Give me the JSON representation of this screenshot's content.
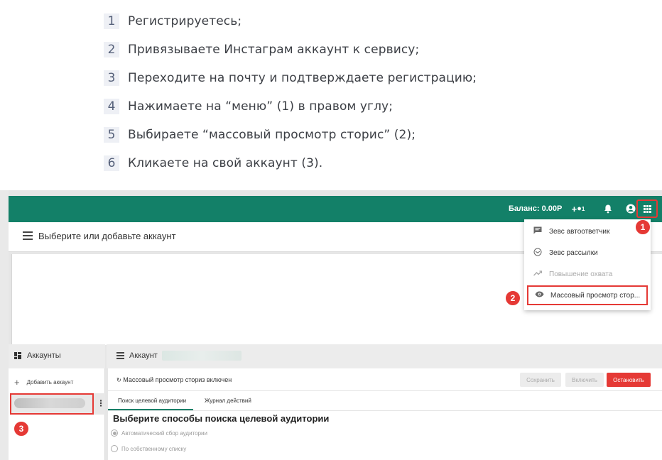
{
  "steps": [
    {
      "num": "1",
      "text": "Регистрируетесь;"
    },
    {
      "num": "2",
      "text": "Привязываете Инстаграм аккаунт к сервису;"
    },
    {
      "num": "3",
      "text": "Переходите на почту и подтверждаете регистрацию;"
    },
    {
      "num": "4",
      "text": "Нажимаете на “меню” (1) в правом углу;"
    },
    {
      "num": "5",
      "text": "Выбираете “массовый просмотр сторис” (2);"
    },
    {
      "num": "6",
      "text": "Кликаете на свой аккаунт (3)."
    }
  ],
  "app": {
    "topbar": {
      "balance": "Баланс: 0.00Р",
      "add_user_badge": "1",
      "accent_color": "#138068"
    },
    "header": {
      "title": "Выберите или добавьте аккаунт"
    },
    "menu": {
      "items": [
        {
          "label": "Зевс автоответчик",
          "icon": "chat-icon",
          "disabled": false
        },
        {
          "label": "Зевс рассылки",
          "icon": "mail-icon",
          "disabled": false
        },
        {
          "label": "Повышение охвата",
          "icon": "trending-up-icon",
          "disabled": true
        },
        {
          "label": "Массовый просмотр стор...",
          "icon": "eye-icon",
          "disabled": false
        }
      ]
    },
    "annotations": {
      "badge1": "1",
      "badge2": "2",
      "badge3": "3",
      "highlight_color": "#e53935"
    },
    "accounts_panel": {
      "title": "Аккаунты",
      "add_account": "Добавить аккаунт"
    },
    "account_panel": {
      "title": "Аккаунт",
      "status": "Массовый просмотр сториз включен",
      "buttons": {
        "save": "Сохранить",
        "enable": "Включить",
        "stop": "Остановить"
      },
      "tabs": [
        "Поиск целевой аудитории",
        "Журнал действий"
      ],
      "section_title": "Выберите способы поиска целевой аудитории",
      "options": [
        "Автоматический сбор аудитории",
        "По собственному списку"
      ]
    }
  }
}
